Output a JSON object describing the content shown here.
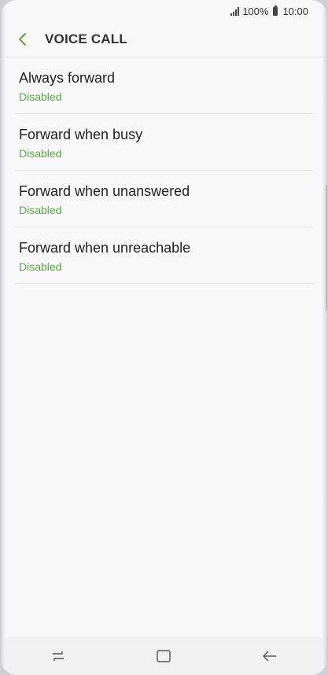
{
  "status_bar": {
    "battery_text": "100%",
    "time": "10:00"
  },
  "header": {
    "title": "VOICE CALL",
    "back_icon": "chevron-left-icon",
    "accent_color": "#5aa845"
  },
  "items": [
    {
      "label": "Always forward",
      "status": "Disabled"
    },
    {
      "label": "Forward when busy",
      "status": "Disabled"
    },
    {
      "label": "Forward when unanswered",
      "status": "Disabled"
    },
    {
      "label": "Forward when unreachable",
      "status": "Disabled"
    }
  ],
  "nav_bar": {
    "icons": [
      "recent-apps-icon",
      "home-icon",
      "back-arrow-icon"
    ]
  }
}
